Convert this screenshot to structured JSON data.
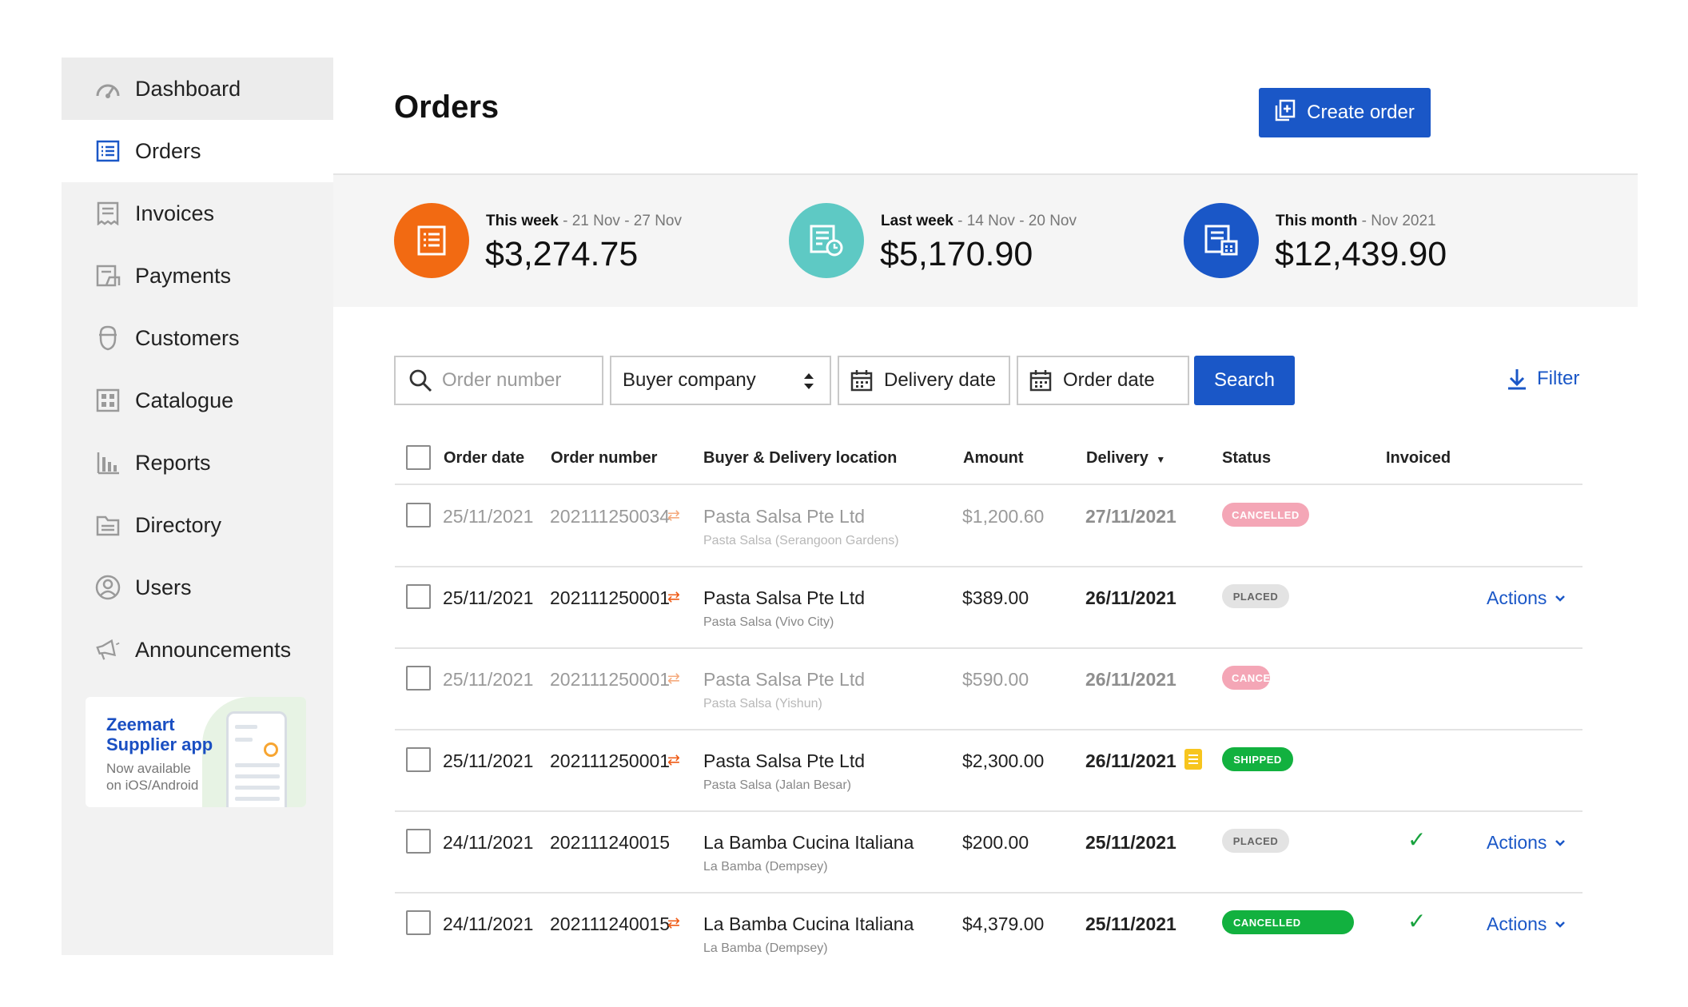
{
  "sidebar": {
    "items": [
      {
        "label": "Dashboard",
        "icon": "gauge-icon"
      },
      {
        "label": "Orders",
        "icon": "orders-list-icon"
      },
      {
        "label": "Invoices",
        "icon": "invoice-icon"
      },
      {
        "label": "Payments",
        "icon": "payment-icon"
      },
      {
        "label": "Customers",
        "icon": "customer-icon"
      },
      {
        "label": "Catalogue",
        "icon": "catalogue-icon"
      },
      {
        "label": "Reports",
        "icon": "bar-chart-icon"
      },
      {
        "label": "Directory",
        "icon": "folder-icon"
      },
      {
        "label": "Users",
        "icon": "user-icon"
      },
      {
        "label": "Announcements",
        "icon": "megaphone-icon"
      }
    ],
    "promo": {
      "title_line1": "Zeemart",
      "title_line2": "Supplier app",
      "sub_line1": "Now available",
      "sub_line2": "on iOS/Android"
    }
  },
  "header": {
    "title": "Orders",
    "create_label": "Create order"
  },
  "stats": [
    {
      "period": "This week",
      "range": " - 21 Nov - 27 Nov",
      "value": "$3,274.75",
      "color": "#f26a12"
    },
    {
      "period": "Last week",
      "range": " - 14 Nov - 20 Nov",
      "value": "$5,170.90",
      "color": "#5ec9c4"
    },
    {
      "period": "This month",
      "range": " - Nov 2021",
      "value": "$12,439.90",
      "color": "#1a57c7"
    }
  ],
  "filters": {
    "order_number_placeholder": "Order number",
    "buyer_company": "Buyer company",
    "delivery_date": "Delivery date",
    "order_date": "Order date",
    "search_label": "Search",
    "filter_label": "Filter"
  },
  "table": {
    "headers": {
      "order_date": "Order date",
      "order_number": "Order number",
      "buyer": "Buyer & Delivery location",
      "amount": "Amount",
      "delivery": "Delivery",
      "status": "Status",
      "invoiced": "Invoiced"
    },
    "rows": [
      {
        "order_date": "25/11/2021",
        "order_number": "202111250034",
        "buyer": "Pasta Salsa Pte Ltd",
        "location": "Pasta Salsa (Serangoon Gardens)",
        "amount": "$1,200.60",
        "delivery": "27/11/2021",
        "status": "CANCELLED",
        "actions": ""
      },
      {
        "order_date": "25/11/2021",
        "order_number": "202111250001",
        "buyer": "Pasta Salsa Pte Ltd",
        "location": "Pasta Salsa (Vivo City)",
        "amount": "$389.00",
        "delivery": "26/11/2021",
        "status": "PLACED",
        "actions": "Actions"
      },
      {
        "order_date": "25/11/2021",
        "order_number": "202111250001",
        "buyer": "Pasta Salsa Pte Ltd",
        "location": "Pasta Salsa (Yishun)",
        "amount": "$590.00",
        "delivery": "26/11/2021",
        "status": "CANCE",
        "actions": ""
      },
      {
        "order_date": "25/11/2021",
        "order_number": "202111250001",
        "buyer": "Pasta Salsa Pte Ltd",
        "location": "Pasta Salsa (Jalan Besar)",
        "amount": "$2,300.00",
        "delivery": "26/11/2021",
        "status": "SHIPPED",
        "actions": ""
      },
      {
        "order_date": "24/11/2021",
        "order_number": "202111240015",
        "buyer": "La Bamba Cucina Italiana",
        "location": "La Bamba (Dempsey)",
        "amount": "$200.00",
        "delivery": "25/11/2021",
        "status": "PLACED",
        "actions": "Actions"
      },
      {
        "order_date": "24/11/2021",
        "order_number": "202111240015",
        "buyer": "La Bamba Cucina Italiana",
        "location": "La Bamba (Dempsey)",
        "amount": "$4,379.00",
        "delivery": "25/11/2021",
        "status": "CANCELLED",
        "actions": "Actions"
      }
    ]
  }
}
